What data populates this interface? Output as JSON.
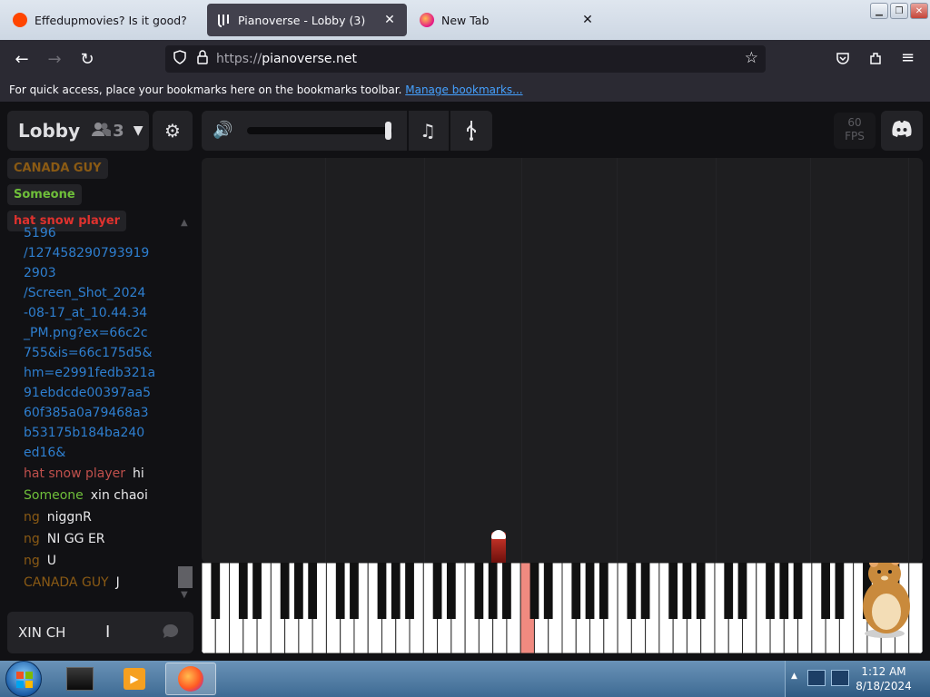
{
  "browser": {
    "tabs": [
      {
        "title": "Effedupmovies? Is it good? : r/D",
        "active": false
      },
      {
        "title": "Pianoverse - Lobby (3)",
        "active": true
      },
      {
        "title": "New Tab",
        "active": false
      }
    ],
    "url_proto": "https://",
    "url_host": "pianoverse.net",
    "bookmarks_text": "For quick access, place your bookmarks here on the bookmarks toolbar.",
    "bookmarks_link": "Manage bookmarks..."
  },
  "room": {
    "name": "Lobby",
    "user_count": "3"
  },
  "fps": {
    "value": "60",
    "label": "FPS"
  },
  "users": [
    {
      "name": "CANADA GUY",
      "color": "#8a5a14"
    },
    {
      "name": "Someone",
      "color": "#6fbf3a"
    },
    {
      "name": "hat snow player",
      "color": "#e0322e"
    }
  ],
  "chat": {
    "link_lines": [
      "5196",
      "/127458290793919",
      "2903",
      "/Screen_Shot_2024",
      "-08-17_at_10.44.34",
      "_PM.png?ex=66c2c",
      "755&is=66c175d5&",
      "hm=e2991fedb321a",
      "91ebdcde00397aa5",
      "60f385a0a79468a3",
      "b53175b184ba240",
      "ed16&"
    ],
    "messages": [
      {
        "user": "hat snow player",
        "color": "#c0504c",
        "text": "hi"
      },
      {
        "user": "Someone",
        "color": "#6fbf3a",
        "text": "xin chaoi"
      },
      {
        "user": "ng",
        "color": "#8a5a14",
        "text": "niggnR"
      },
      {
        "user": "ng",
        "color": "#8a5a14",
        "text": "NI GG ER"
      },
      {
        "user": "ng",
        "color": "#8a5a14",
        "text": "U"
      },
      {
        "user": "CANADA GUY",
        "color": "#8a5a14",
        "text": "J"
      }
    ],
    "input_value": "XIN CH"
  },
  "piano": {
    "white_keys": 52,
    "pressed_white_index": 23,
    "pressed_color": "#f08a80"
  },
  "taskbar": {
    "time": "1:12 AM",
    "date": "8/18/2024"
  }
}
